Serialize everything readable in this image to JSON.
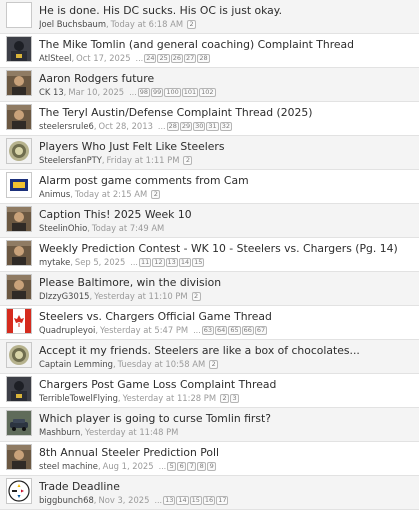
{
  "threads": [
    {
      "title": "He is done. His DC sucks. His OC is just okay.",
      "author": "Joel Buchsbaum",
      "time": "Today at 6:18 AM",
      "pages": [
        "2"
      ],
      "avatar_icon": "blank-avatar-icon"
    },
    {
      "title": "The Mike Tomlin (and general coaching) Complaint Thread",
      "author": "AtlSteel",
      "time": "Oct 17, 2025",
      "pages": [
        "24",
        "25",
        "26",
        "27",
        "28"
      ],
      "avatar_icon": "player-photo-avatar-icon"
    },
    {
      "title": "Aaron Rodgers future",
      "author": "CK 13",
      "time": "Mar 10, 2025",
      "pages": [
        "98",
        "99",
        "100",
        "101",
        "102"
      ],
      "avatar_icon": "photo-avatar-icon"
    },
    {
      "title": "The Teryl Austin/Defense Complaint Thread (2025)",
      "author": "steelersrule6",
      "time": "Oct 28, 2013",
      "pages": [
        "28",
        "29",
        "30",
        "31",
        "32"
      ],
      "avatar_icon": "photo-avatar-icon"
    },
    {
      "title": "Players Who Just Felt Like Steelers",
      "author": "SteelersfanPTY",
      "time": "Friday at 1:11 PM",
      "pages": [
        "2"
      ],
      "avatar_icon": "coin-avatar-icon"
    },
    {
      "title": "Alarm post game comments from Cam",
      "author": "Animus",
      "time": "Today at 2:15 AM",
      "pages": [
        "2"
      ],
      "avatar_icon": "pitt-logo-avatar-icon"
    },
    {
      "title": "Caption This! 2025 Week 10",
      "author": "SteelinOhio",
      "time": "Today at 7:49 AM",
      "pages": [],
      "avatar_icon": "photo-avatar-icon"
    },
    {
      "title": "Weekly Prediction Contest - WK 10 - Steelers vs. Chargers (Pg. 14)",
      "author": "mytake",
      "time": "Sep 5, 2025",
      "pages": [
        "11",
        "12",
        "13",
        "14",
        "15"
      ],
      "avatar_icon": "photo-avatar-icon"
    },
    {
      "title": "Please Baltimore, win the division",
      "author": "DIzzyG3015",
      "time": "Yesterday at 11:10 PM",
      "pages": [
        "2"
      ],
      "avatar_icon": "photo-avatar-icon"
    },
    {
      "title": "Steelers vs. Chargers Official Game Thread",
      "author": "Quadrupleyoi",
      "time": "Yesterday at 5:47 PM",
      "pages": [
        "63",
        "64",
        "65",
        "66",
        "67"
      ],
      "avatar_icon": "flag-avatar-icon"
    },
    {
      "title": "Accept it my friends. Steelers are like a box of chocolates...",
      "author": "Captain Lemming",
      "time": "Tuesday at 10:58 AM",
      "pages": [
        "2"
      ],
      "avatar_icon": "coin-avatar-icon"
    },
    {
      "title": "Chargers Post Game Loss Complaint Thread",
      "author": "TerribleTowelFlying",
      "time": "Yesterday at 11:28 PM",
      "pages": [
        "2",
        "3"
      ],
      "avatar_icon": "player-photo-avatar-icon"
    },
    {
      "title": "Which player is going to curse Tomlin first?",
      "author": "Mashburn",
      "time": "Yesterday at 11:48 PM",
      "pages": [],
      "avatar_icon": "car-photo-avatar-icon"
    },
    {
      "title": "8th Annual Steeler Prediction Poll",
      "author": "steel machine",
      "time": "Aug 1, 2025",
      "pages": [
        "5",
        "6",
        "7",
        "8",
        "9"
      ],
      "avatar_icon": "photo-avatar-icon"
    },
    {
      "title": "Trade Deadline",
      "author": "biggbunch68",
      "time": "Nov 3, 2025",
      "pages": [
        "13",
        "14",
        "15",
        "16",
        "17"
      ],
      "avatar_icon": "steelers-logo-avatar-icon"
    }
  ],
  "pager_dots": "...",
  "separator": ","
}
